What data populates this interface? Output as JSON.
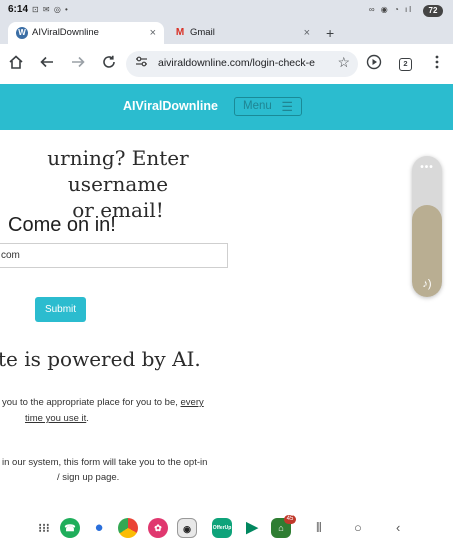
{
  "status_bar": {
    "time": "6:14",
    "left_icons": "⊡ ✉ ◎ •",
    "right_icons": "∞ ◉ ◔ ıl",
    "battery": "72"
  },
  "tabs": [
    {
      "label": "AIViralDownline",
      "favicon": "W",
      "close": "×"
    },
    {
      "label": "Gmail",
      "favicon": "M",
      "close": "×"
    }
  ],
  "new_tab": "+",
  "toolbar": {
    "url": "aiviraldownline.com/login-check-e",
    "tab_count": "2"
  },
  "site": {
    "brand": "AIViralDownline",
    "menu_label": "Menu",
    "headline_line1": "urning? Enter username",
    "headline_line2": "or email!",
    "subhead": "Come on in!",
    "input_value": "com",
    "submit_label": "Submit",
    "powered_text": "te is powered by AI.",
    "para1_line1_a": "you to the appropriate place for you to be, ",
    "para1_line1_b": "every",
    "para1_line2": "time you use it",
    "para1_line2_end": ".",
    "para2_line1": "in our system, this form will take you to the opt-in",
    "para2_line2": "/ sign up page."
  },
  "volume_panel": {
    "dots": "•••",
    "level_percent": 65,
    "icon": "♪)"
  },
  "taskbar": {
    "badge": "45",
    "apps": [
      "apps-grid",
      "phone",
      "messages",
      "chrome",
      "gallery",
      "camera",
      "offerup",
      "play-store",
      "home-app"
    ]
  },
  "colors": {
    "accent": "#2bbccf",
    "chrome_bg": "#dfe3ea"
  }
}
